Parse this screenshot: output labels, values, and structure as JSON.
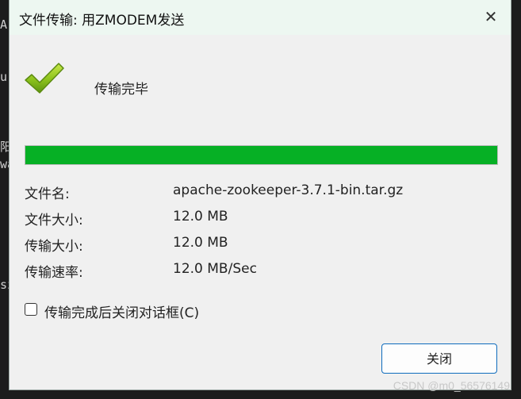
{
  "dialog": {
    "title": "文件传输: 用ZMODEM发送",
    "close_icon": "✕",
    "status": "传输完毕",
    "progress_percent": 100,
    "progress_color": "#06b025",
    "info": [
      {
        "label": "文件名:",
        "value": "apache-zookeeper-3.7.1-bin.tar.gz"
      },
      {
        "label": "文件大小:",
        "value": "12.0 MB"
      },
      {
        "label": "传输大小:",
        "value": "12.0 MB"
      },
      {
        "label": "传输速率:",
        "value": "12.0 MB/Sec"
      }
    ],
    "auto_close_checkbox": {
      "label": "传输完成后关闭对话框(C)",
      "checked": false
    },
    "close_button": "关闭"
  },
  "background_terminal": {
    "visible_chars": [
      "A",
      "u",
      "阳",
      "wa",
      "sz"
    ]
  },
  "watermark": "CSDN @m0_56576149"
}
